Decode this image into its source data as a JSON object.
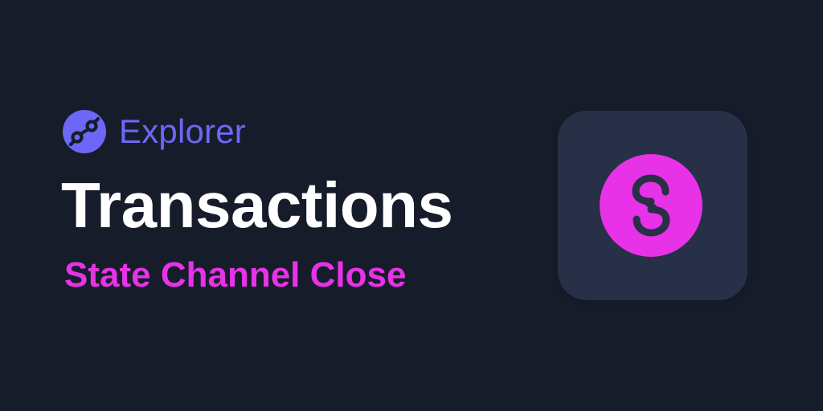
{
  "header": {
    "brand_name": "Explorer",
    "brand_icon": "helium-logo-icon"
  },
  "main": {
    "title": "Transactions",
    "subtitle": "State Channel Close"
  },
  "tile": {
    "icon": "state-channel-close-icon"
  },
  "colors": {
    "background": "#171c2b",
    "tile_background": "#273046",
    "brand_accent": "#6d67f7",
    "subtitle_accent": "#e832e8",
    "title_text": "#ffffff"
  }
}
